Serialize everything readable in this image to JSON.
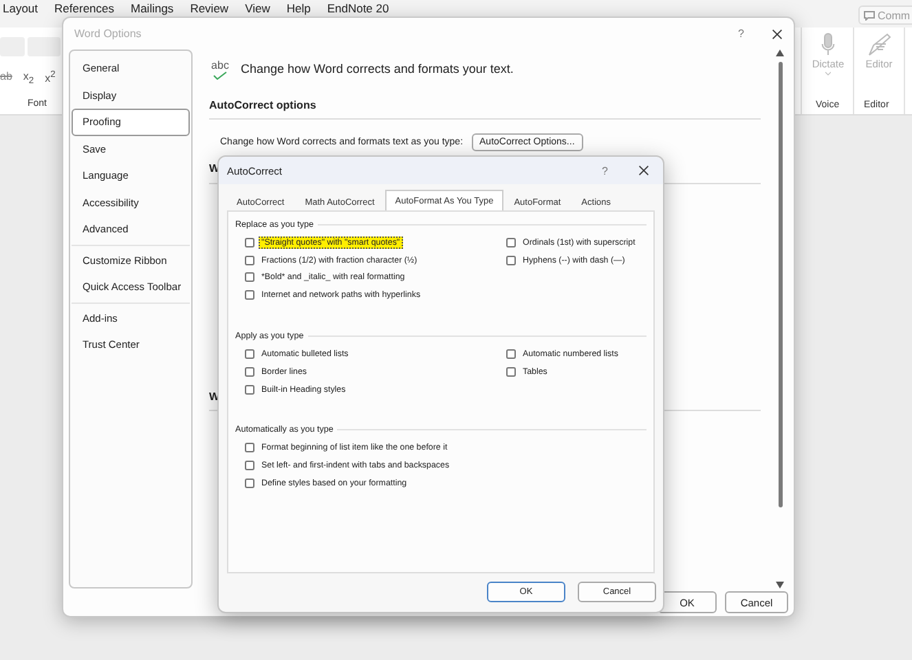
{
  "word_ribbon": {
    "tabs": [
      "Layout",
      "References",
      "Mailings",
      "Review",
      "View",
      "Help",
      "EndNote 20"
    ],
    "comments_button": "Comm",
    "font_group": {
      "buttons": [
        "ab",
        "x$_{2}$",
        "x$^{2}$"
      ],
      "label": "Font"
    },
    "voice_group": {
      "button": "Dictate",
      "label": "Voice"
    },
    "editor_group": {
      "button": "Editor",
      "label": "Editor"
    }
  },
  "word_options": {
    "title": "Word Options",
    "help": "?",
    "sidebar": [
      {
        "items": [
          {
            "label": "General",
            "selected": false
          },
          {
            "label": "Display",
            "selected": false
          },
          {
            "label": "Proofing",
            "selected": true
          },
          {
            "label": "Save",
            "selected": false
          },
          {
            "label": "Language",
            "selected": false
          },
          {
            "label": "Accessibility",
            "selected": false
          },
          {
            "label": "Advanced",
            "selected": false
          }
        ]
      },
      {
        "items": [
          {
            "label": "Customize Ribbon",
            "selected": false
          },
          {
            "label": "Quick Access Toolbar",
            "selected": false
          }
        ]
      },
      {
        "items": [
          {
            "label": "Add-ins",
            "selected": false
          },
          {
            "label": "Trust Center",
            "selected": false
          }
        ]
      }
    ],
    "icon_label": "abc",
    "header": "Change how Word corrects and formats your text.",
    "section_title": "AutoCorrect options",
    "prompt": "Change how Word corrects and formats text as you type:",
    "options_button": "AutoCorrect Options...",
    "hidden_headings": [
      "W",
      "W"
    ],
    "buttons": [
      "OK",
      "Cancel"
    ]
  },
  "autocorrect": {
    "title": "AutoCorrect",
    "help": "?",
    "tabs": [
      {
        "label": "AutoCorrect",
        "selected": false
      },
      {
        "label": "Math AutoCorrect",
        "selected": false
      },
      {
        "label": "AutoFormat As You Type",
        "selected": true
      },
      {
        "label": "AutoFormat",
        "selected": false
      },
      {
        "label": "Actions",
        "selected": false
      }
    ],
    "sections": [
      {
        "title": "Replace as you type",
        "columns": [
          [
            {
              "label": "\"Straight quotes\" with \"smart quotes\"",
              "checked": false,
              "highlighted": true
            },
            {
              "label": "Fractions (1/2) with fraction character (½)",
              "checked": false,
              "highlighted": false
            },
            {
              "label": "*Bold* and _italic_ with real formatting",
              "checked": false,
              "highlighted": false
            },
            {
              "label": "Internet and network paths with hyperlinks",
              "checked": false,
              "highlighted": false
            }
          ],
          [
            {
              "label": "Ordinals (1st) with superscript",
              "checked": false,
              "highlighted": false
            },
            {
              "label": "Hyphens (--) with dash (—)",
              "checked": false,
              "highlighted": false
            }
          ]
        ]
      },
      {
        "title": "Apply as you type",
        "columns": [
          [
            {
              "label": "Automatic bulleted lists",
              "checked": false,
              "highlighted": false
            },
            {
              "label": "Border lines",
              "checked": false,
              "highlighted": false
            },
            {
              "label": "Built-in Heading styles",
              "checked": false,
              "highlighted": false
            }
          ],
          [
            {
              "label": "Automatic numbered lists",
              "checked": false,
              "highlighted": false
            },
            {
              "label": "Tables",
              "checked": false,
              "highlighted": false
            }
          ]
        ]
      },
      {
        "title": "Automatically as you type",
        "columns": [
          [
            {
              "label": "Format beginning of list item like the one before it",
              "checked": false,
              "highlighted": false
            },
            {
              "label": "Set left- and first-indent with tabs and backspaces",
              "checked": false,
              "highlighted": false
            },
            {
              "label": "Define styles based on your formatting",
              "checked": false,
              "highlighted": false
            }
          ]
        ]
      }
    ],
    "buttons": [
      {
        "label": "OK",
        "default": true
      },
      {
        "label": "Cancel",
        "default": false
      }
    ]
  }
}
